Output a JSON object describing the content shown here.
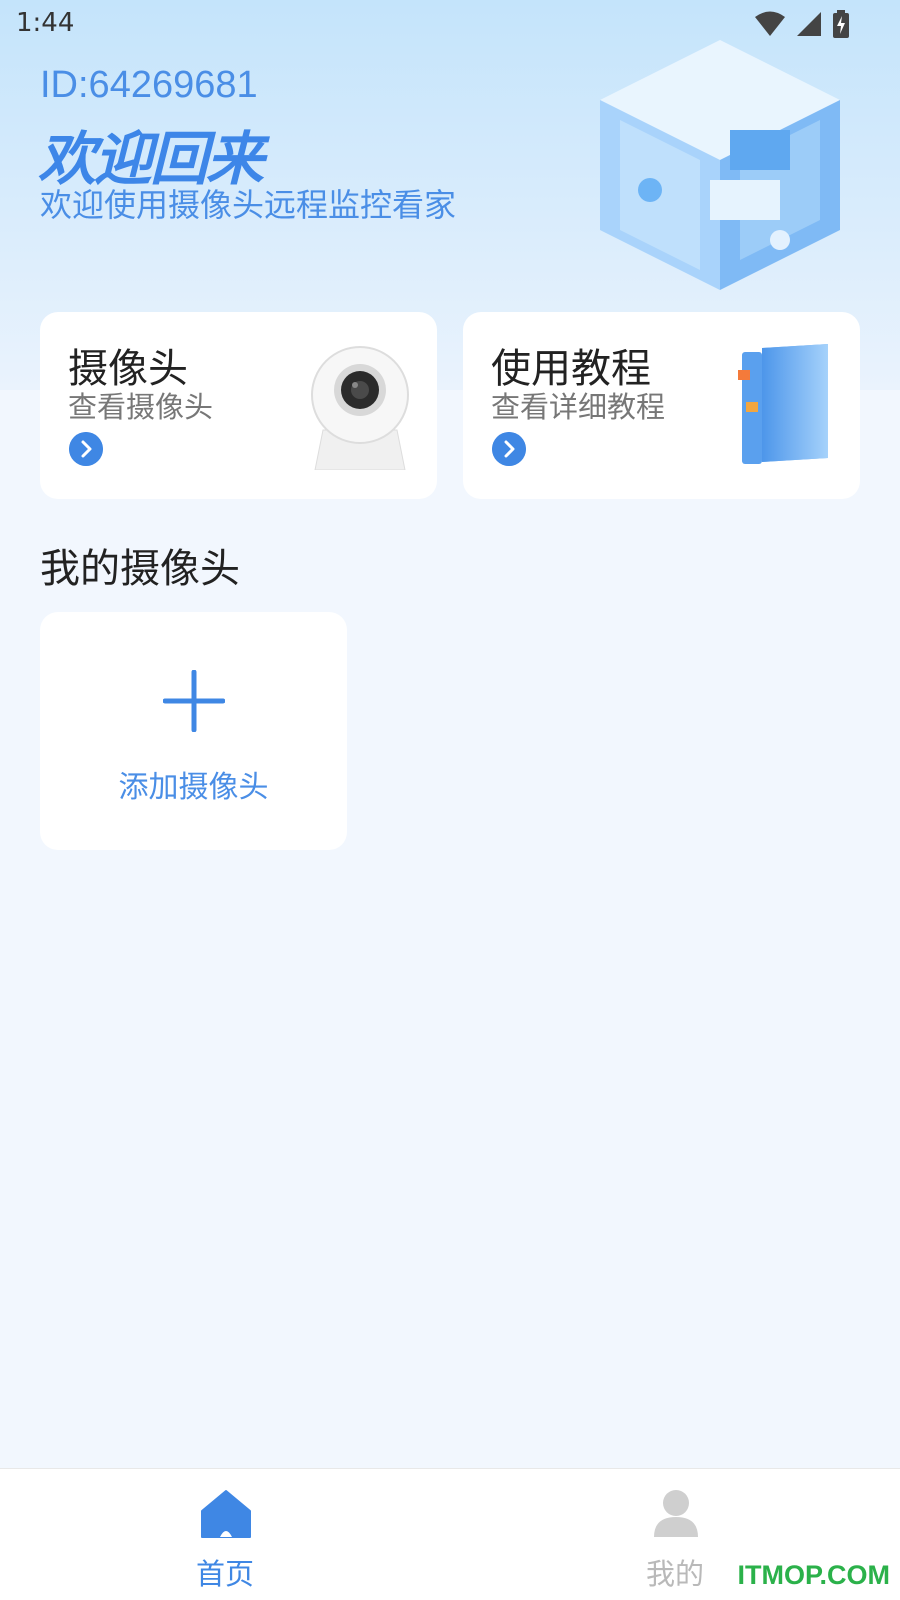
{
  "status_bar": {
    "time": "1:44",
    "icons": [
      "wifi-icon",
      "signal-icon",
      "battery-charging-icon"
    ]
  },
  "header": {
    "user_id": "ID:64269681",
    "title": "欢迎回来",
    "subtitle": "欢迎使用摄像头远程监控看家"
  },
  "cards": {
    "camera": {
      "title": "摄像头",
      "subtitle": "查看摄像头"
    },
    "tutorial": {
      "title": "使用教程",
      "subtitle": "查看详细教程"
    }
  },
  "my_cameras": {
    "title": "我的摄像头",
    "add_label": "添加摄像头"
  },
  "bottom_nav": {
    "items": [
      {
        "label": "首页",
        "icon": "home-icon",
        "active": true
      },
      {
        "label": "我的",
        "icon": "user-icon",
        "active": false
      }
    ]
  },
  "watermark": "ITMOP.COM",
  "colors": {
    "accent": "#3f87e4",
    "background": "#f2f7fe",
    "inactive": "#b9b9b9"
  }
}
